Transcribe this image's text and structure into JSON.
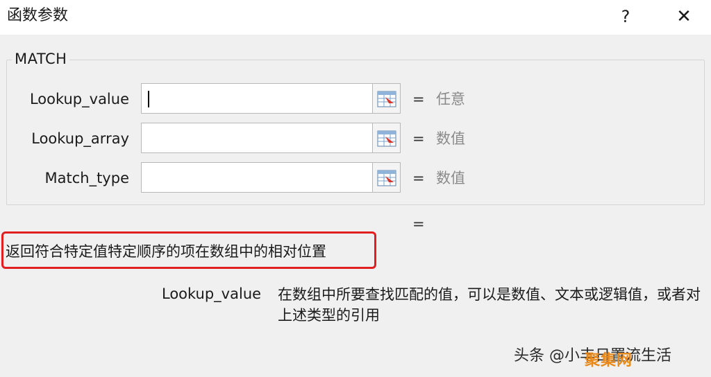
{
  "window": {
    "title": "函数参数",
    "help_label": "?",
    "close_label": "✕"
  },
  "function": {
    "name": "MATCH",
    "args": [
      {
        "label": "Lookup_value",
        "value": "",
        "equals": "=",
        "hint": "任意"
      },
      {
        "label": "Lookup_array",
        "value": "",
        "equals": "=",
        "hint": "数值"
      },
      {
        "label": "Match_type",
        "value": "",
        "equals": "=",
        "hint": "数值"
      }
    ],
    "result_equals": "=",
    "description": "返回符合特定值特定顺序的项在数组中的相对位置",
    "param_name": "Lookup_value",
    "param_description": "在数组中所要查找匹配的值，可以是数值、文本或逻辑值，或者对上述类型的引用"
  },
  "watermark": {
    "text": "头条 @小丰日置流生活",
    "logo": "聚集网"
  },
  "icons": {
    "ref_button": "range-select-icon"
  },
  "colors": {
    "highlight_border": "#e02020",
    "titlebar_bg": "#ffffff",
    "dialog_bg": "#f0f0f0"
  }
}
